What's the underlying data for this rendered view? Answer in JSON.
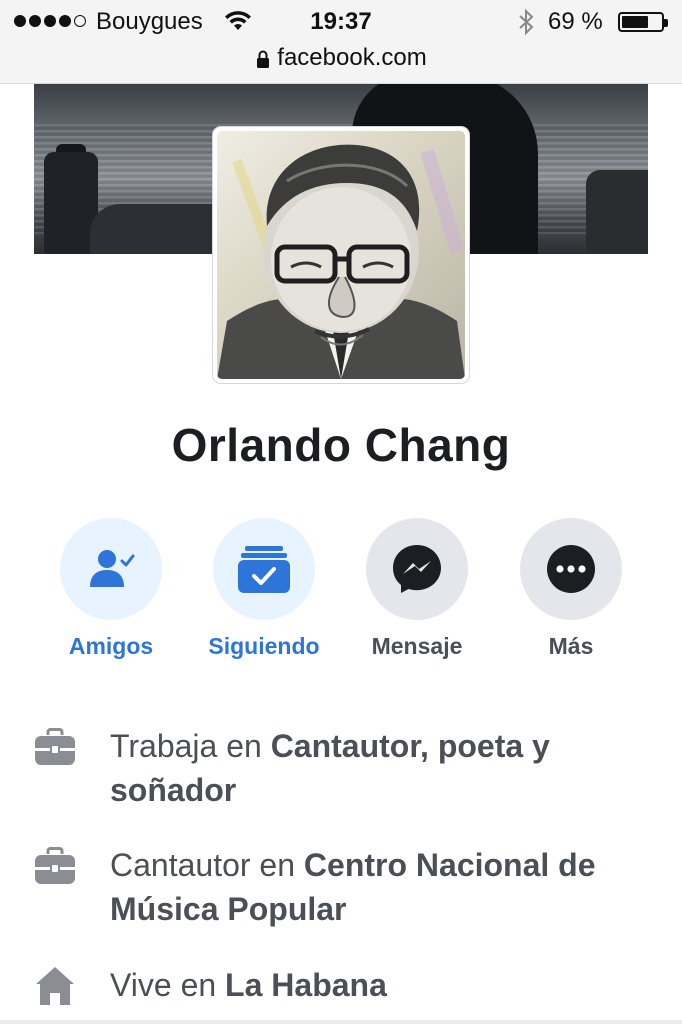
{
  "status_bar": {
    "carrier": "Bouygues",
    "time": "19:37",
    "battery_percent": "69 %",
    "battery_level": 0.69,
    "signal_bars_filled": 4,
    "signal_bars_total": 5
  },
  "browser": {
    "url": "facebook.com"
  },
  "profile": {
    "name": "Orlando Chang"
  },
  "actions": [
    {
      "label": "Amigos",
      "icon": "friends-check-icon",
      "style": "active"
    },
    {
      "label": "Siguiendo",
      "icon": "following-check-icon",
      "style": "active"
    },
    {
      "label": "Mensaje",
      "icon": "messenger-icon",
      "style": "default"
    },
    {
      "label": "Más",
      "icon": "more-dots-icon",
      "style": "default"
    }
  ],
  "info": [
    {
      "icon": "briefcase-icon",
      "prefix": "Trabaja en ",
      "bold": "Cantautor, poeta y soñador"
    },
    {
      "icon": "briefcase-icon",
      "prefix": "Cantautor en ",
      "bold": "Centro Nacional de Música Popular"
    },
    {
      "icon": "home-icon",
      "prefix": "Vive en ",
      "bold": "La Habana"
    }
  ],
  "colors": {
    "accent": "#2d75d8",
    "accent_bg": "#e7f3ff",
    "neutral_bg": "#e4e6eb",
    "text": "#1c1e21",
    "secondary_text": "#4b4f56"
  }
}
